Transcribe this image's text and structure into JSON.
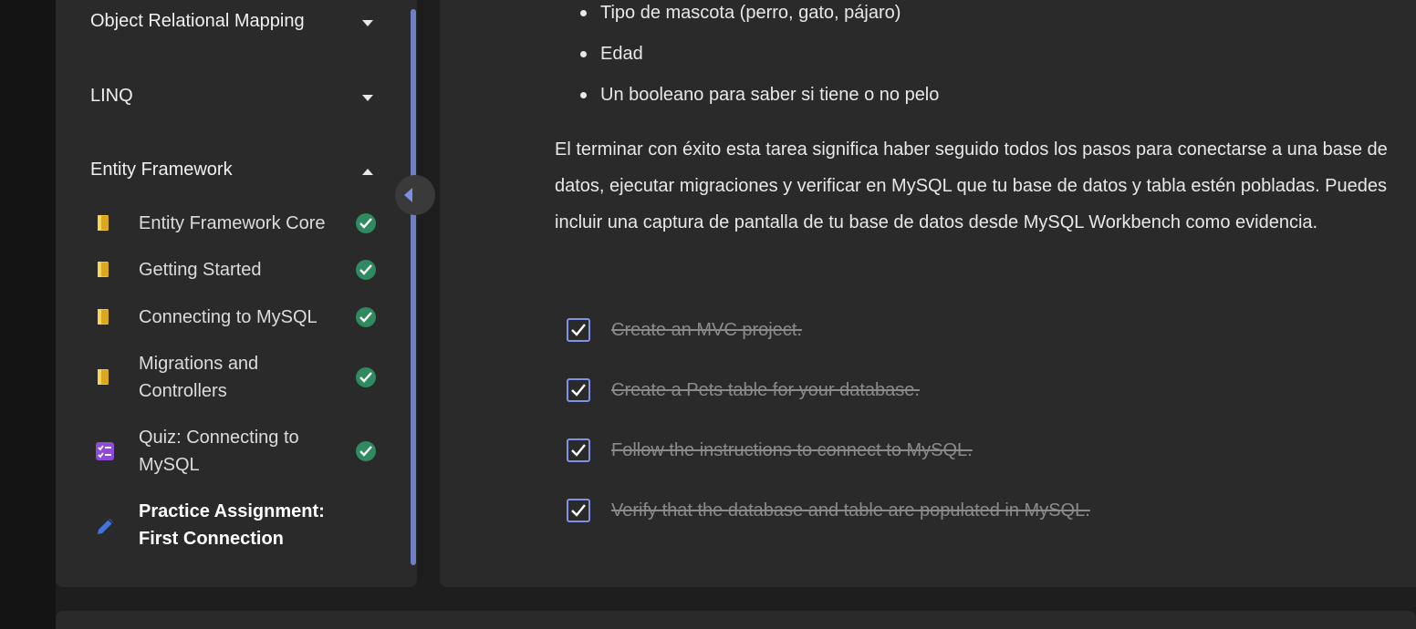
{
  "sidebar": {
    "sections": [
      {
        "label": "Object Relational Mapping",
        "expanded": false
      },
      {
        "label": "LINQ",
        "expanded": false
      },
      {
        "label": "Entity Framework",
        "expanded": true
      }
    ],
    "lessons": [
      {
        "label": "Entity Framework Core",
        "icon": "book-icon",
        "completed": true
      },
      {
        "label": "Getting Started",
        "icon": "book-icon",
        "completed": true
      },
      {
        "label": "Connecting to MySQL",
        "icon": "book-icon",
        "completed": true
      },
      {
        "label": "Migrations and Controllers",
        "icon": "book-icon",
        "completed": true
      },
      {
        "label": "Quiz: Connecting to MySQL",
        "icon": "quiz-icon",
        "completed": true
      },
      {
        "label": "Practice Assignment: First Connection",
        "icon": "pencil-icon",
        "completed": false,
        "active": true
      }
    ]
  },
  "main": {
    "bullets": [
      "Tipo de mascota (perro, gato, pájaro)",
      "Edad",
      "Un booleano para saber si tiene o no pelo"
    ],
    "paragraph": "El terminar con éxito esta tarea significa haber seguido todos los pasos para conectarse a una base de datos, ejecutar migraciones y verificar en MySQL que tu base de datos y tabla estén pobladas. Puedes incluir una captura de pantalla de tu base de datos desde MySQL Workbench como evidencia.",
    "tasks": [
      {
        "label": "Create an MVC project.",
        "checked": true
      },
      {
        "label": "Create a Pets table for your database.",
        "checked": true
      },
      {
        "label": "Follow the instructions to connect to MySQL.",
        "checked": true
      },
      {
        "label": "Verify that the database and table are populated in MySQL.",
        "checked": true
      }
    ]
  },
  "colors": {
    "accent": "#7f92e8",
    "completed": "#2f8a5f",
    "book": "#f2c230",
    "quiz": "#8f4bd6",
    "pencil": "#3f73e0"
  }
}
